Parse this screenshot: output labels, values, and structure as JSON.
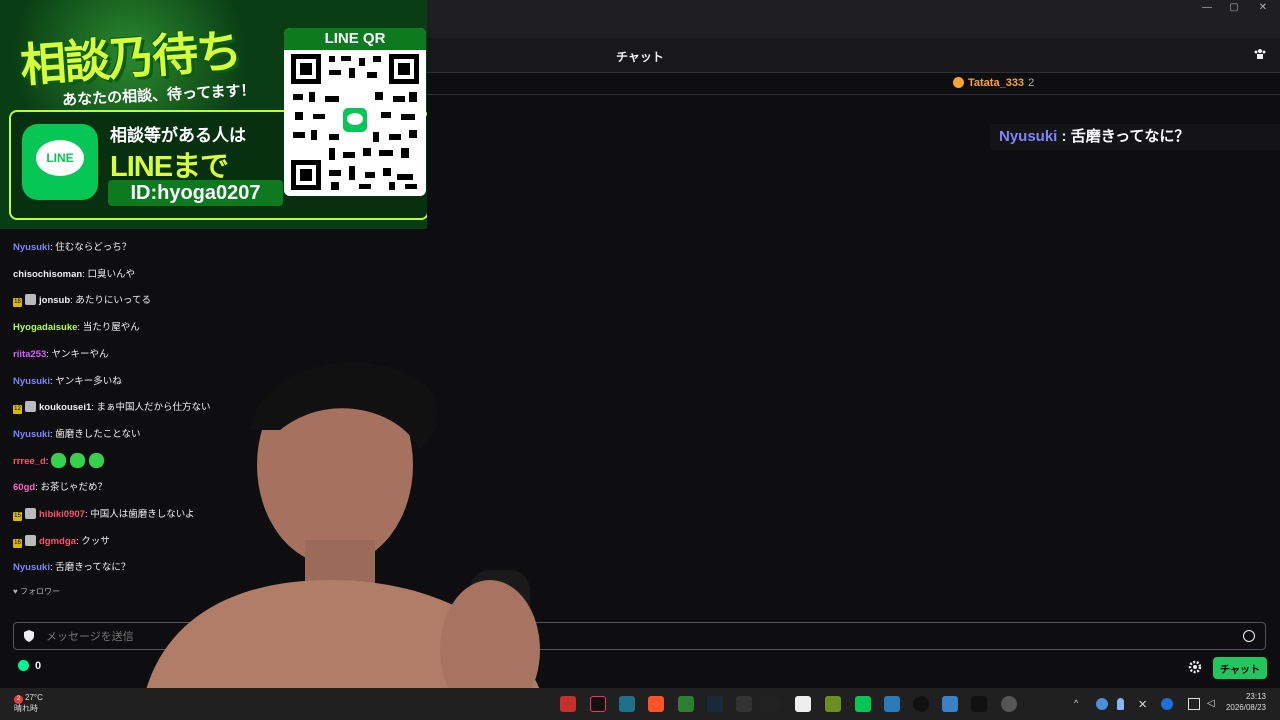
{
  "window": {
    "min_glyph": "—",
    "max_glyph": "▢",
    "close_glyph": "✕"
  },
  "chat_header": {
    "title": "チャット",
    "users_icon": "users-icon"
  },
  "pinned_cheer": {
    "username": "Tatata_333",
    "count": "2",
    "icon": "coin-icon"
  },
  "highlight_message": {
    "username": "Nyusuki",
    "separator": " : ",
    "text": "舌磨きってなに？"
  },
  "overlay": {
    "headline": "相談乃待ち",
    "subline": "あなたの相談、待ってます！",
    "qr_label": "LINE QR",
    "line_logo_text": "LINE",
    "promo_line1": "相談等がある人は",
    "promo_line2": "LINEまで",
    "line_id": "ID:hyoga0207"
  },
  "messages": [
    {
      "username": "Nyusuki",
      "text": ": 住むならどっち？",
      "color": "#7c83fd",
      "badge": "",
      "avatar": false
    },
    {
      "username": "chisochisoman",
      "text": ": 口臭いんや",
      "color": "#efeff1",
      "badge": "",
      "avatar": false
    },
    {
      "username": "jonsub",
      "text": ": あたりにいってる",
      "color": "#efeff1",
      "badge": "18",
      "avatar": true
    },
    {
      "username": "Hyogadaisuke",
      "text": ": 当たり屋やん",
      "color": "#b7ff3a",
      "badge": "",
      "avatar": false
    },
    {
      "username": "riita253",
      "text": ": ヤンキーやん",
      "color": "#d15cff",
      "badge": "",
      "avatar": false
    },
    {
      "username": "Nyusuki",
      "text": ": ヤンキー多いね",
      "color": "#7c83fd",
      "badge": "",
      "avatar": false
    },
    {
      "username": "koukousei1",
      "text": ": まぁ中国人だから仕方ない",
      "color": "#efeff1",
      "badge": "12",
      "avatar": true
    },
    {
      "username": "Nyusuki",
      "text": ": 歯磨きしたことない",
      "color": "#7c83fd",
      "badge": "",
      "avatar": false
    },
    {
      "username": "rrree_d",
      "text": ":",
      "color": "#ff4d6d",
      "badge": "",
      "avatar": false,
      "emotes": 3
    },
    {
      "username": "60gd",
      "text": ": お茶じゃだめ？",
      "color": "#ff5fc8",
      "badge": "",
      "avatar": false
    },
    {
      "username": "hibiki0907",
      "text": ": 中国人は歯磨きしないよ",
      "color": "#ff4d6d",
      "badge": "15",
      "avatar": true
    },
    {
      "username": "dgmdga",
      "text": ": クッサ",
      "color": "#ff4d6d",
      "badge": "16",
      "avatar": true
    },
    {
      "username": "Nyusuki",
      "text": ": 舌磨きってなに？",
      "color": "#7c83fd",
      "badge": "",
      "avatar": false
    }
  ],
  "follow_notice": "フォロワー",
  "input": {
    "placeholder": "メッセージを送信"
  },
  "points": {
    "value": "0"
  },
  "send_button": "チャット",
  "taskbar": {
    "weather_temp": "27°C",
    "weather_desc": "晴れ時",
    "notification_count": "2",
    "time": "23:13",
    "date": "2026/08/23"
  }
}
